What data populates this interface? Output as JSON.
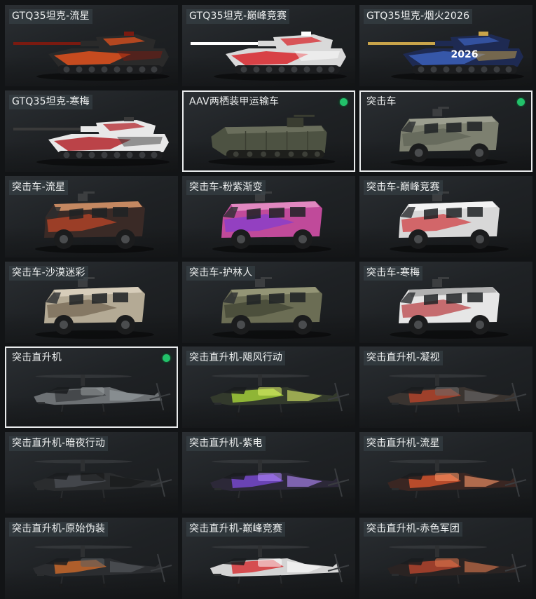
{
  "selected_indicator_color": "#22c26a",
  "items": [
    {
      "label": "GTQ35坦克-流星",
      "kind": "tank",
      "body": "#2a2a2a",
      "accent": "#e2511d",
      "accent2": "#7a1a10",
      "selected": false
    },
    {
      "label": "GTQ35坦克-巅峰竞赛",
      "kind": "tank",
      "body": "#d9d9d9",
      "accent": "#d7262b",
      "accent2": "#ffffff",
      "selected": false
    },
    {
      "label": "GTQ35坦克-烟火2026",
      "kind": "tank",
      "body": "#1e2a52",
      "accent": "#3b5fb8",
      "accent2": "#c9a44a",
      "badge": "2026",
      "selected": false
    },
    {
      "label": "GTQ35坦克-寒梅",
      "kind": "tank",
      "body": "#e8e8e8",
      "accent": "#b3262c",
      "accent2": "#3a3a3a",
      "selected": false
    },
    {
      "label": "AAV两栖装甲运输车",
      "kind": "aav",
      "body": "#4d5242",
      "accent": "#3a3d31",
      "accent2": "#6a6e5c",
      "selected": true
    },
    {
      "label": "突击车",
      "kind": "truck",
      "body": "#7d8070",
      "accent": "#5c5f53",
      "accent2": "#a9ab9d",
      "selected": true
    },
    {
      "label": "突击车-流星",
      "kind": "truck",
      "body": "#3a2a26",
      "accent": "#cf4a28",
      "accent2": "#ffb07a",
      "selected": false
    },
    {
      "label": "突击车-粉紫渐变",
      "kind": "truck",
      "body": "#c04a9a",
      "accent": "#7b3bd6",
      "accent2": "#f0a2d0",
      "selected": false
    },
    {
      "label": "突击车-巅峰竞赛",
      "kind": "truck",
      "body": "#d8d8d8",
      "accent": "#cf2a2e",
      "accent2": "#ffffff",
      "selected": false
    },
    {
      "label": "突击车-沙漠迷彩",
      "kind": "truck",
      "body": "#b4aa95",
      "accent": "#6b5e4a",
      "accent2": "#e5dccb",
      "selected": false
    },
    {
      "label": "突击车-护林人",
      "kind": "truck",
      "body": "#6b6d54",
      "accent": "#3c3f30",
      "accent2": "#a5a684",
      "selected": false
    },
    {
      "label": "突击车-寒梅",
      "kind": "truck",
      "body": "#e6e6e6",
      "accent": "#b32b30",
      "accent2": "#9a9a9a",
      "selected": false
    },
    {
      "label": "突击直升机",
      "kind": "heli",
      "body": "#6d7174",
      "accent": "#3b3e41",
      "accent2": "#9aa0a3",
      "selected": true
    },
    {
      "label": "突击直升机-飓风行动",
      "kind": "heli",
      "body": "#333a2c",
      "accent": "#a6d43a",
      "accent2": "#e0f26b",
      "selected": false
    },
    {
      "label": "突击直升机-凝视",
      "kind": "heli",
      "body": "#3a3430",
      "accent": "#b8442b",
      "accent2": "#6b6b6b",
      "selected": false
    },
    {
      "label": "突击直升机-暗夜行动",
      "kind": "heli",
      "body": "#2a2c2e",
      "accent": "#4a4e52",
      "accent2": "#141516",
      "selected": false
    },
    {
      "label": "突击直升机-紫电",
      "kind": "heli",
      "body": "#2c2838",
      "accent": "#7a4ad4",
      "accent2": "#b58aff",
      "selected": false
    },
    {
      "label": "突击直升机-流星",
      "kind": "heli",
      "body": "#3a2622",
      "accent": "#d8552e",
      "accent2": "#ff9a6a",
      "selected": false
    },
    {
      "label": "突击直升机-原始伪装",
      "kind": "heli",
      "body": "#2b2d30",
      "accent": "#d06a2a",
      "accent2": "#5a5e62",
      "selected": false
    },
    {
      "label": "突击直升机-巅峰竞赛",
      "kind": "heli",
      "body": "#d4d4d4",
      "accent": "#d42a2e",
      "accent2": "#ffffff",
      "selected": false
    },
    {
      "label": "突击直升机-赤色军团",
      "kind": "heli",
      "body": "#2a2322",
      "accent": "#b8452e",
      "accent2": "#e07a50",
      "selected": false
    }
  ]
}
